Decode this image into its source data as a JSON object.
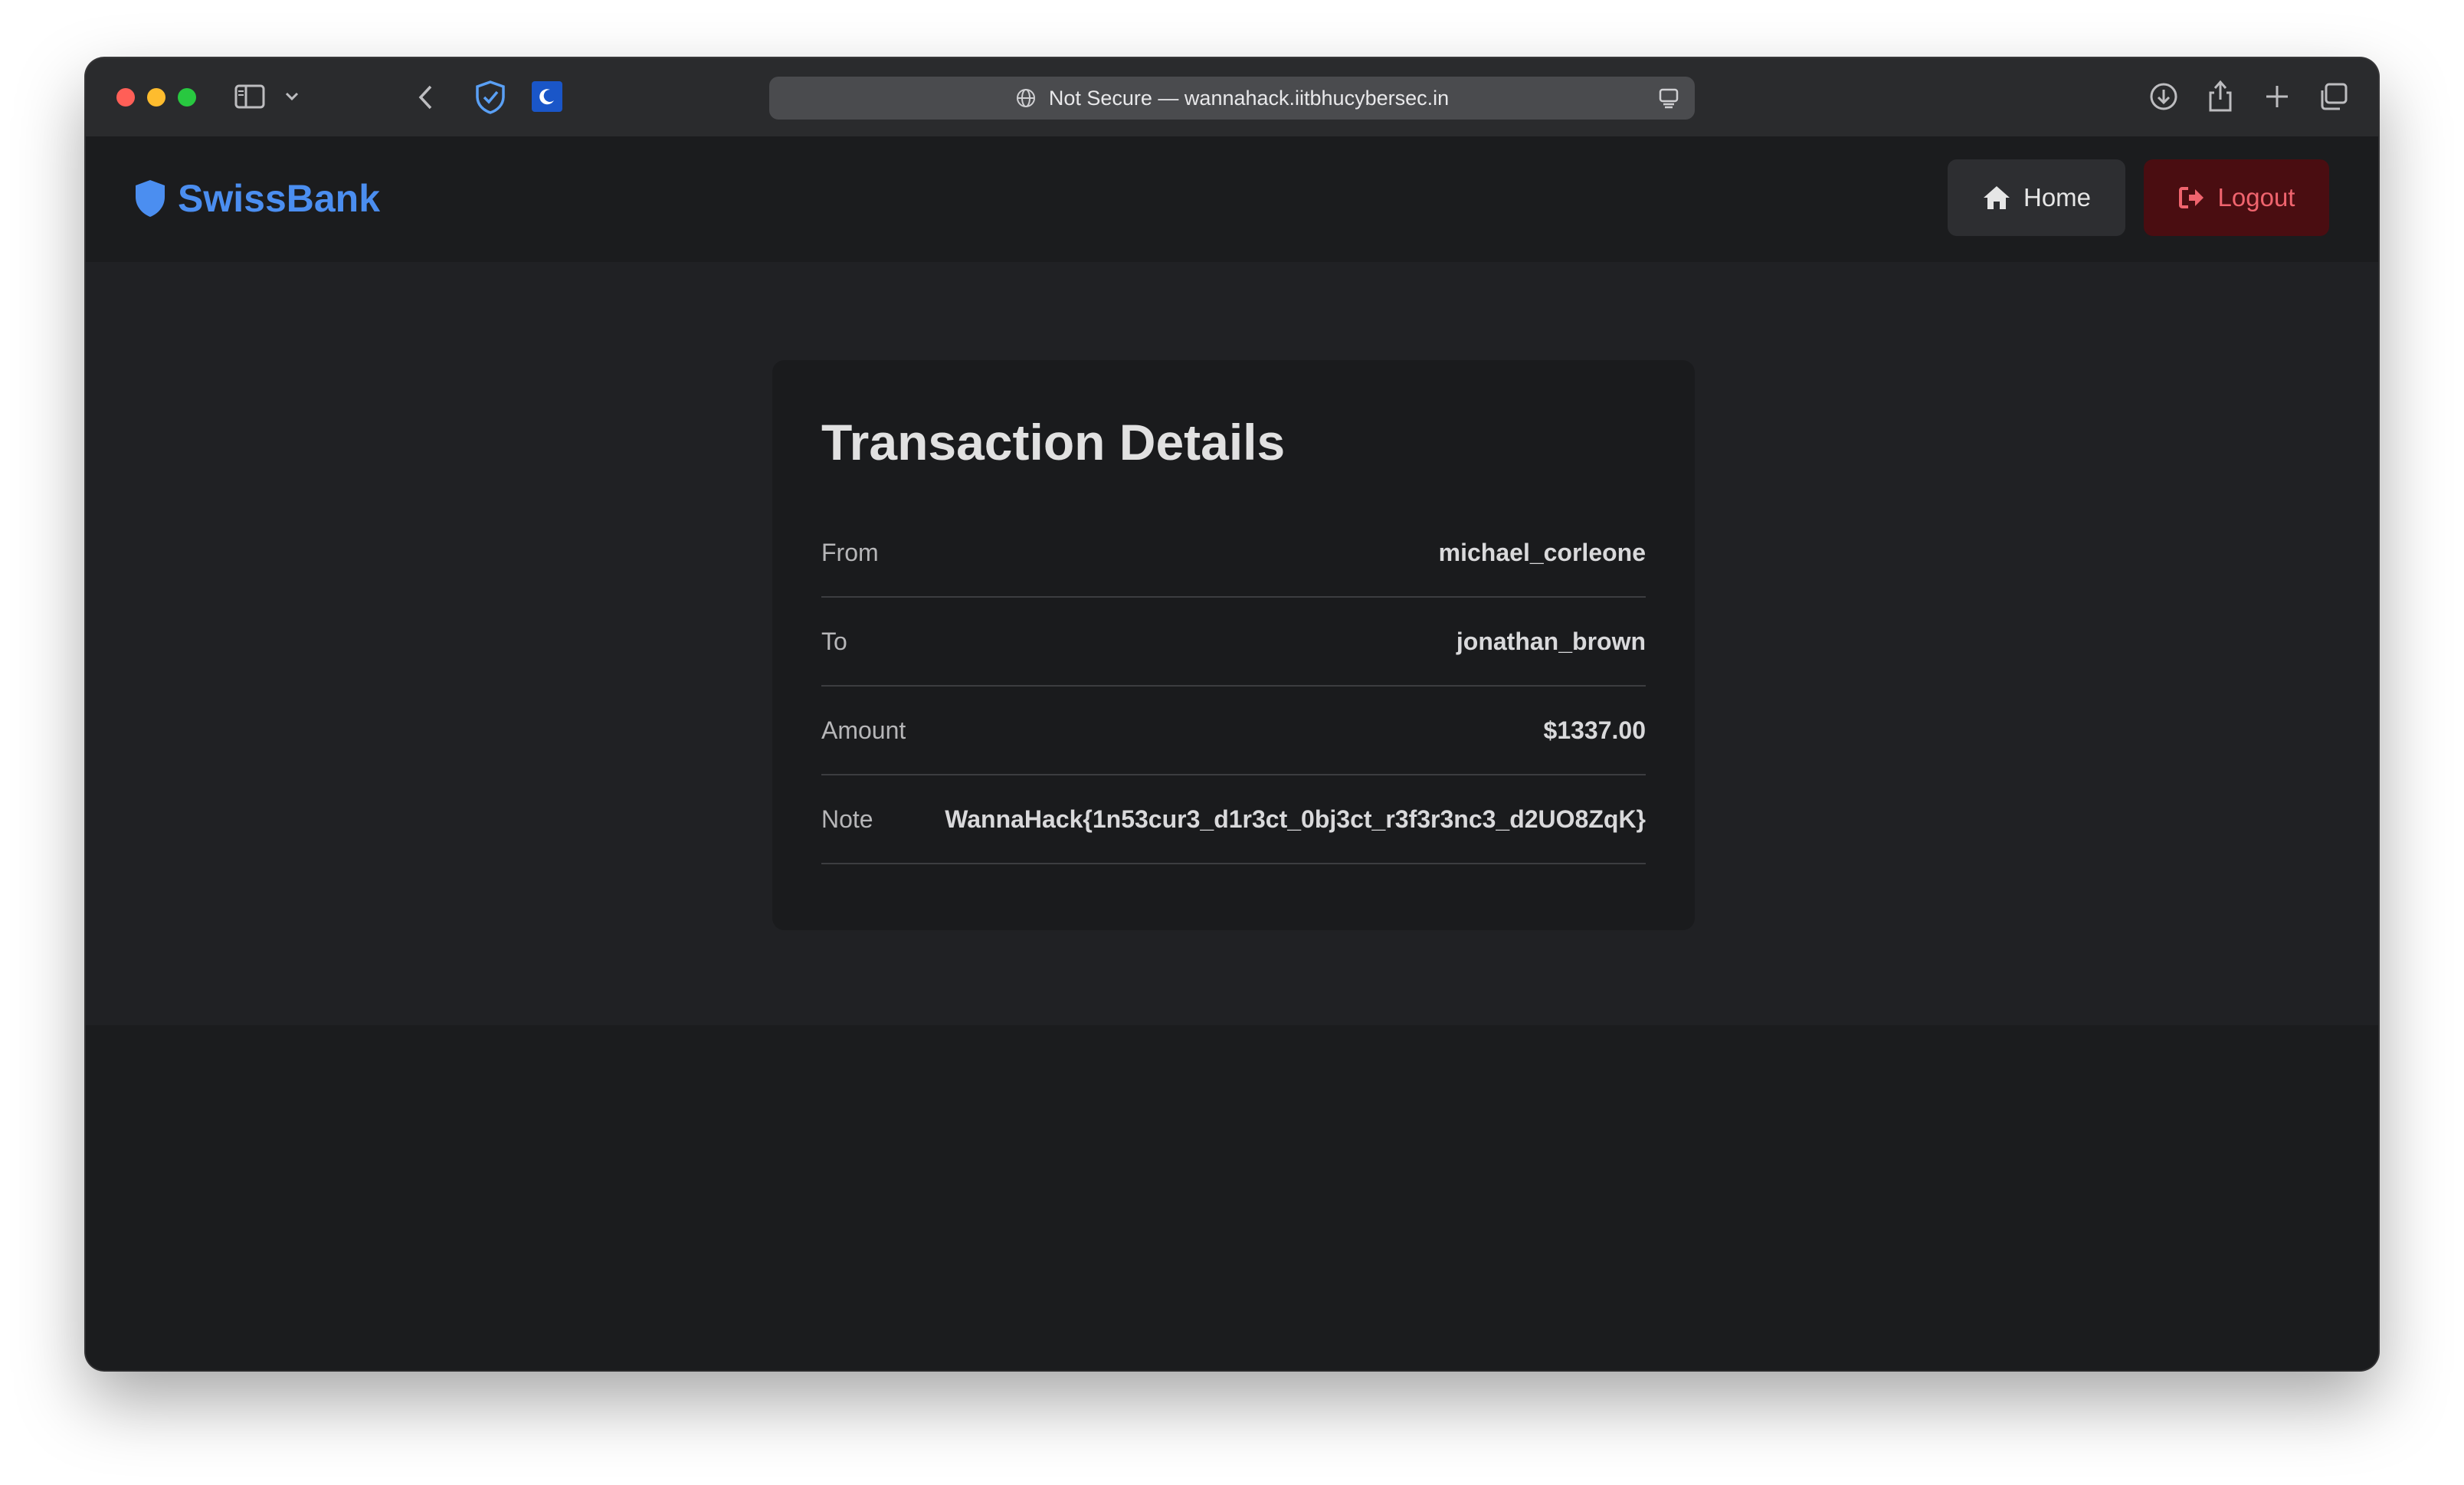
{
  "browser": {
    "address_text": "Not Secure — wannahack.iitbhucybersec.in"
  },
  "navbar": {
    "brand": "SwissBank",
    "home_label": "Home",
    "logout_label": "Logout",
    "brand_color": "#4b8ef0",
    "logout_color": "#f0646e"
  },
  "transaction": {
    "title": "Transaction Details",
    "rows": [
      {
        "label": "From",
        "value": "michael_corleone"
      },
      {
        "label": "To",
        "value": "jonathan_brown"
      },
      {
        "label": "Amount",
        "value": "$1337.00"
      },
      {
        "label": "Note",
        "value": "WannaHack{1n53cur3_d1r3ct_0bj3ct_r3f3r3nc3_d2UO8ZqK}"
      }
    ]
  }
}
